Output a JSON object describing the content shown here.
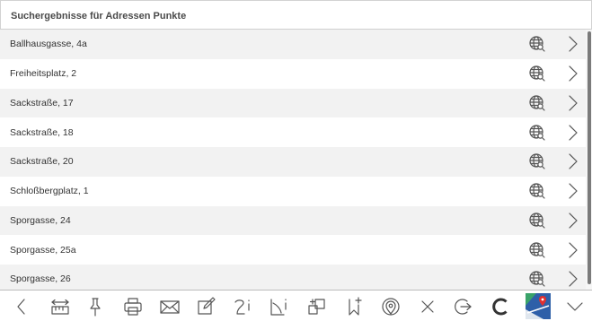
{
  "header": {
    "title": "Suchergebnisse für Adressen Punkte"
  },
  "results": [
    {
      "label": "Ballhausgasse, 4a"
    },
    {
      "label": "Freiheitsplatz, 2"
    },
    {
      "label": "Sackstraße, 17"
    },
    {
      "label": "Sackstraße, 18"
    },
    {
      "label": "Sackstraße, 20"
    },
    {
      "label": "Schloßbergplatz, 1"
    },
    {
      "label": "Sporgasse, 24"
    },
    {
      "label": "Sporgasse, 25a"
    },
    {
      "label": "Sporgasse, 26"
    }
  ],
  "row_icons": {
    "locate": "globe-search-icon",
    "open": "chevron-right-icon"
  },
  "toolbar": {
    "icons": [
      "back-arrow-icon",
      "measure-icon",
      "pin-icon",
      "print-icon",
      "mail-icon",
      "edit-icon",
      "info-text-icon",
      "info-area-icon",
      "copy-icon",
      "bookmark-add-icon",
      "location-icon",
      "close-icon",
      "logout-icon",
      "refresh-icon",
      "map-logo-icon",
      "expand-icon"
    ]
  },
  "colors": {
    "row_alt": "#f2f2f2",
    "icon": "#555555",
    "refresh": "#333333",
    "map_logo_blue": "#2e5fa8",
    "map_logo_red": "#e03030",
    "map_logo_green": "#3aa36a"
  }
}
